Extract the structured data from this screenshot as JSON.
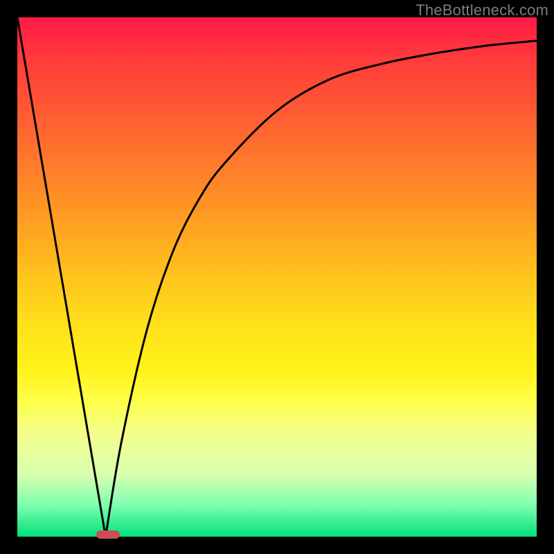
{
  "watermark": "TheBottleneck.com",
  "chart_data": {
    "type": "line",
    "title": "",
    "xlabel": "",
    "ylabel": "",
    "xlim": [
      0,
      100
    ],
    "ylim": [
      0,
      100
    ],
    "grid": false,
    "legend": false,
    "background_gradient": {
      "stops": [
        {
          "pos": 0.0,
          "color": "#ff1a47"
        },
        {
          "pos": 0.5,
          "color": "#ffc41d"
        },
        {
          "pos": 0.74,
          "color": "#fdff4a"
        },
        {
          "pos": 1.0,
          "color": "#00e07a"
        }
      ]
    },
    "series": [
      {
        "name": "left-line",
        "x": [
          0,
          17
        ],
        "y": [
          100,
          0
        ]
      },
      {
        "name": "right-curve",
        "x": [
          17,
          20,
          25,
          30,
          35,
          40,
          50,
          60,
          70,
          80,
          90,
          100
        ],
        "y": [
          0,
          18,
          40,
          55,
          65,
          72,
          82,
          88,
          91,
          93,
          94.5,
          95.5
        ]
      }
    ],
    "marker": {
      "x": 17.5,
      "y": 0,
      "shape": "pill",
      "color": "#cc4d52"
    }
  },
  "colors": {
    "frame": "#000000",
    "curve": "#000000",
    "marker": "#cc4d52",
    "watermark": "#7c7c7c"
  }
}
